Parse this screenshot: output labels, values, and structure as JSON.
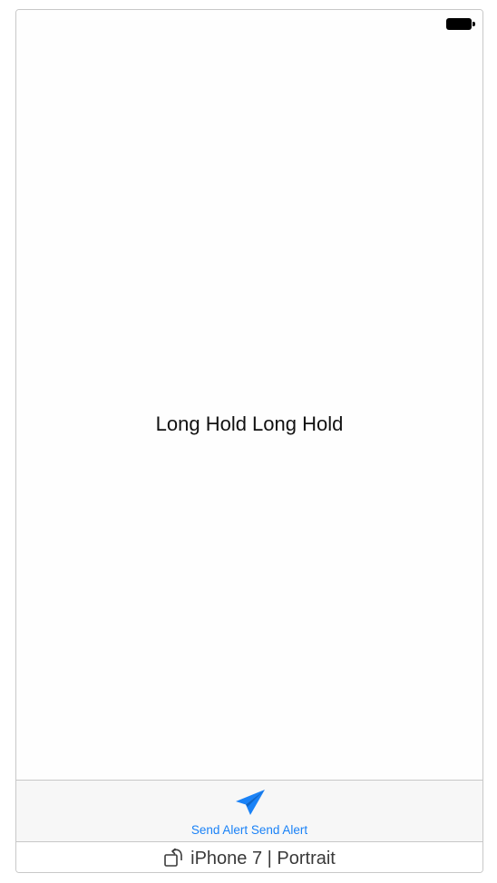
{
  "status_bar": {
    "battery_icon": "battery-full-icon"
  },
  "main": {
    "center_label": "Long Hold Long Hold"
  },
  "tab_bar": {
    "items": [
      {
        "label": "Send Alert Send Alert",
        "icon": "paper-plane-icon",
        "color": "#1a82f7"
      }
    ]
  },
  "footer": {
    "rotate_icon": "rotate-device-icon",
    "device_label": "iPhone 7 | Portrait"
  }
}
